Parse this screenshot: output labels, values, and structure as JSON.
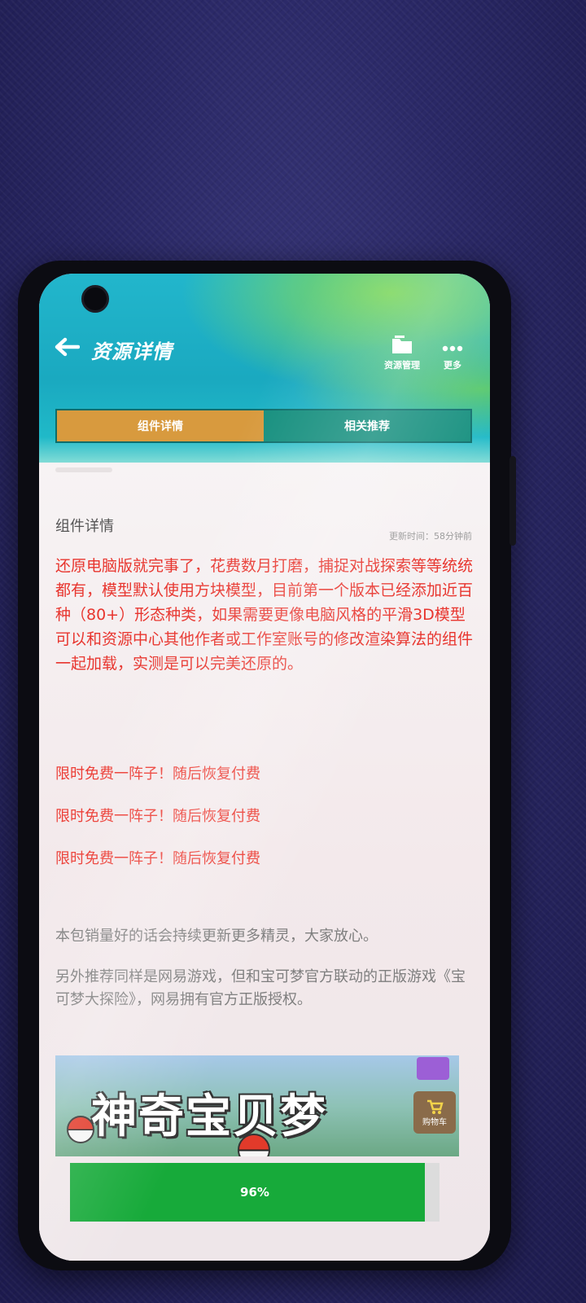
{
  "header": {
    "title": "资源详情",
    "resource_manage_label": "资源管理",
    "more_label": "更多"
  },
  "tabs": [
    {
      "label": "组件详情",
      "active": true
    },
    {
      "label": "相关推荐",
      "active": false
    }
  ],
  "detail": {
    "section_title": "组件详情",
    "update_time": "更新时间：58分钟前",
    "description": "还原电脑版就完事了，花费数月打磨，捕捉对战探索等等统统都有，模型默认使用方块模型，目前第一个版本已经添加近百种（80+）形态种类，如果需要更像电脑风格的平滑3D模型可以和资源中心其他作者或工作室账号的修改渲染算法的组件一起加载，实测是可以完美还原的。",
    "promos": [
      "限时免费一阵子！随后恢复付费",
      "限时免费一阵子！随后恢复付费",
      "限时免费一阵子！随后恢复付费"
    ],
    "note1": "本包销量好的话会持续更新更多精灵，大家放心。",
    "note2": "另外推荐同样是网易游戏，但和宝可梦官方联动的正版游戏《宝可梦大探险》，网易拥有官方正版授权。"
  },
  "banner": {
    "title": "神奇宝贝梦",
    "cart_label": "购物车"
  },
  "download": {
    "progress_label": "96%",
    "progress_fraction": 0.96
  },
  "colors": {
    "accent_tab": "#d89a3e",
    "header_teal": "#1aa9c0",
    "progress_green": "#17aa3a",
    "text_red": "#e8352e"
  }
}
